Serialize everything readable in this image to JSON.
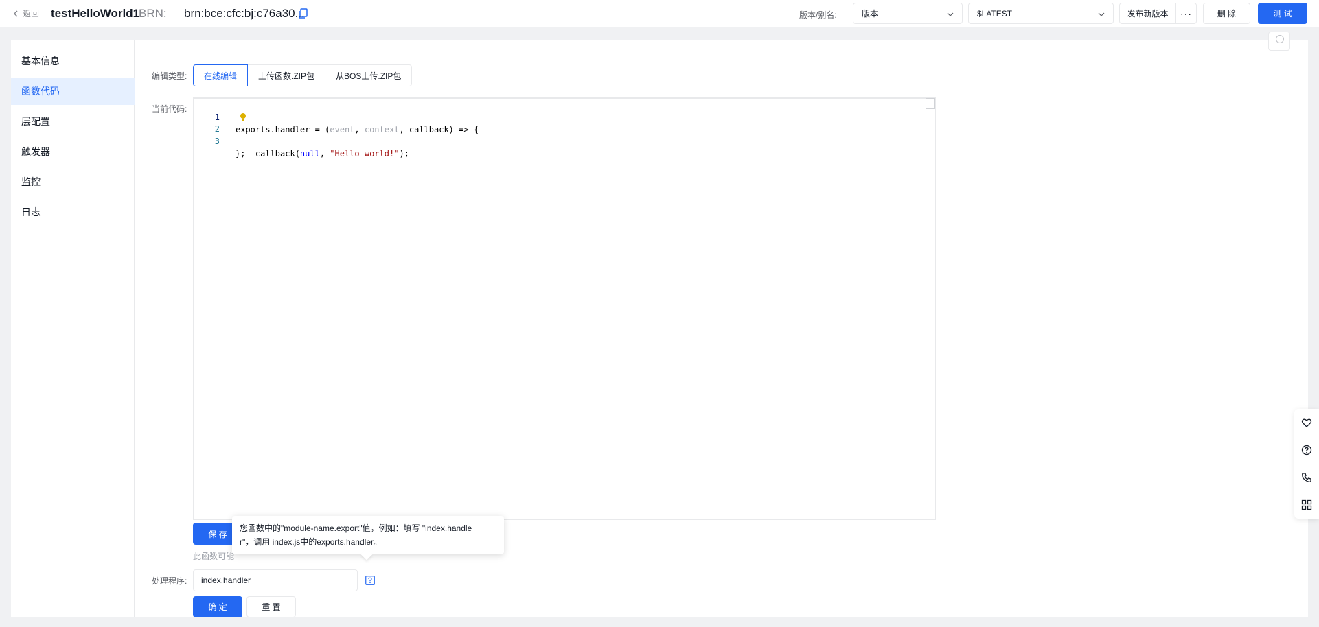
{
  "header": {
    "back_label": "返回",
    "function_name": "testHelloWorld1",
    "brn_label": "BRN:",
    "brn_value": "brn:bce:cfc:bj:c76a30...",
    "version_alias_label": "版本/别名:",
    "version_select_value": "版本",
    "alias_select_value": "$LATEST",
    "publish_button": "发布新版本",
    "more_button": "···",
    "delete_button": "删 除",
    "test_button": "测 试"
  },
  "sidebar": {
    "items": [
      {
        "label": "基本信息"
      },
      {
        "label": "函数代码"
      },
      {
        "label": "层配置"
      },
      {
        "label": "触发器"
      },
      {
        "label": "监控"
      },
      {
        "label": "日志"
      }
    ]
  },
  "main": {
    "section_title": "函数代码",
    "edit_type_label": "编辑类型:",
    "tabs": [
      {
        "label": "在线编辑"
      },
      {
        "label": "上传函数.ZIP包"
      },
      {
        "label": "从BOS上传.ZIP包"
      }
    ],
    "current_code_label": "当前代码:",
    "code_lines": [
      {
        "num": "1"
      },
      {
        "num": "2"
      },
      {
        "num": "3"
      }
    ],
    "save_button": "保 存",
    "hint_text": "此函数可能",
    "tooltip_line1": "您函数中的\"module-name.export\"值，例如：填写 \"index.handle",
    "tooltip_line2": "r\"，调用 index.js中的exports.handler。",
    "handler_label": "处理程序:",
    "handler_value": "index.handler",
    "confirm_button": "确 定",
    "reset_button": "重 置"
  },
  "colors": {
    "primary": "#2468f2",
    "active_nav_bg": "#e6f0ff"
  },
  "icons": [
    "back-chevron-icon",
    "copy-icon",
    "chevron-down-icon",
    "lightbulb-icon",
    "help-icon",
    "heart-icon",
    "question-icon",
    "phone-icon",
    "grid-icon"
  ]
}
